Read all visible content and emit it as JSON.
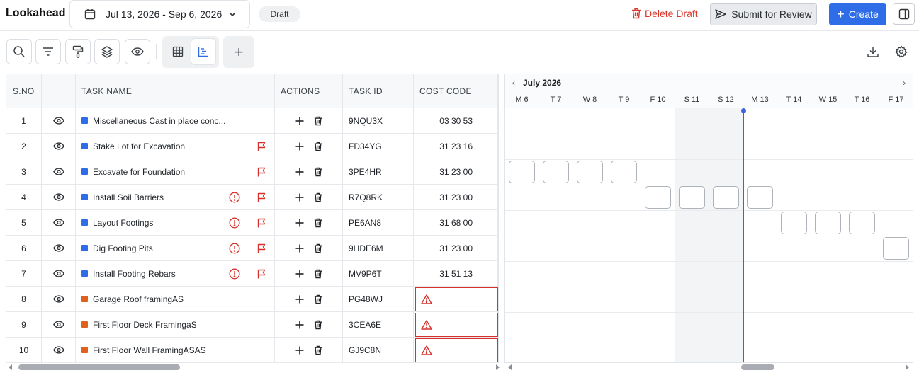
{
  "header": {
    "title": "Lookahead",
    "date_range": "Jul 13, 2026 - Sep 6, 2026",
    "status_badge": "Draft",
    "delete_label": "Delete Draft",
    "submit_label": "Submit for Review",
    "create_label": "Create"
  },
  "toolbar": {
    "icons": [
      "search-icon",
      "filter-icon",
      "paint-roller-icon",
      "layers-icon",
      "eye-icon",
      "grid-view-icon",
      "gantt-view-icon",
      "add-icon",
      "download-icon",
      "settings-icon"
    ],
    "active_view": "gantt"
  },
  "table": {
    "columns": [
      "S.NO",
      "",
      "TASK NAME",
      "ACTIONS",
      "TASK ID",
      "COST CODE"
    ],
    "rows": [
      {
        "sno": "1",
        "color": "#2f6de8",
        "name": "Miscellaneous Cast in place conc...",
        "alert": false,
        "flag": false,
        "task_id": "9NQU3X",
        "cost_code": "03 30 53",
        "cost_error": false
      },
      {
        "sno": "2",
        "color": "#2f6de8",
        "name": "Stake Lot for Excavation",
        "alert": false,
        "flag": true,
        "task_id": "FD34YG",
        "cost_code": "31 23 16",
        "cost_error": false
      },
      {
        "sno": "3",
        "color": "#2f6de8",
        "name": "Excavate for Foundation",
        "alert": false,
        "flag": true,
        "task_id": "3PE4HR",
        "cost_code": "31 23 00",
        "cost_error": false
      },
      {
        "sno": "4",
        "color": "#2f6de8",
        "name": "Install Soil Barriers",
        "alert": true,
        "flag": true,
        "task_id": "R7Q8RK",
        "cost_code": "31 23 00",
        "cost_error": false
      },
      {
        "sno": "5",
        "color": "#2f6de8",
        "name": "Layout Footings",
        "alert": true,
        "flag": true,
        "task_id": "PE6AN8",
        "cost_code": "31 68 00",
        "cost_error": false
      },
      {
        "sno": "6",
        "color": "#2f6de8",
        "name": "Dig Footing Pits",
        "alert": true,
        "flag": true,
        "task_id": "9HDE6M",
        "cost_code": "31 23 00",
        "cost_error": false
      },
      {
        "sno": "7",
        "color": "#2f6de8",
        "name": "Install Footing Rebars",
        "alert": true,
        "flag": true,
        "task_id": "MV9P6T",
        "cost_code": "31 51 13",
        "cost_error": false
      },
      {
        "sno": "8",
        "color": "#e0601d",
        "name": "Garage Roof framingAS",
        "alert": false,
        "flag": false,
        "task_id": "PG48WJ",
        "cost_code": "",
        "cost_error": true
      },
      {
        "sno": "9",
        "color": "#e0601d",
        "name": "First Floor Deck FramingaS",
        "alert": false,
        "flag": false,
        "task_id": "3CEA6E",
        "cost_code": "",
        "cost_error": true
      },
      {
        "sno": "10",
        "color": "#e0601d",
        "name": "First Floor Wall FramingASAS",
        "alert": false,
        "flag": false,
        "task_id": "GJ9C8N",
        "cost_code": "",
        "cost_error": true
      }
    ]
  },
  "gantt": {
    "month": "July 2026",
    "days": [
      "M 6",
      "T 7",
      "W 8",
      "T 9",
      "F 10",
      "S 11",
      "S 12",
      "M 13",
      "T 14",
      "W 15",
      "T 16",
      "F 17"
    ],
    "weekend_days": [
      "S 11",
      "S 12"
    ],
    "today": "M 13",
    "bars": [
      {
        "row": 3,
        "days": [
          "M 6",
          "T 7",
          "W 8",
          "T 9"
        ]
      },
      {
        "row": 4,
        "days": [
          "F 10",
          "S 11",
          "S 12",
          "M 13"
        ]
      },
      {
        "row": 5,
        "days": [
          "T 14",
          "W 15",
          "T 16"
        ]
      },
      {
        "row": 6,
        "days": [
          "F 17"
        ]
      }
    ]
  }
}
